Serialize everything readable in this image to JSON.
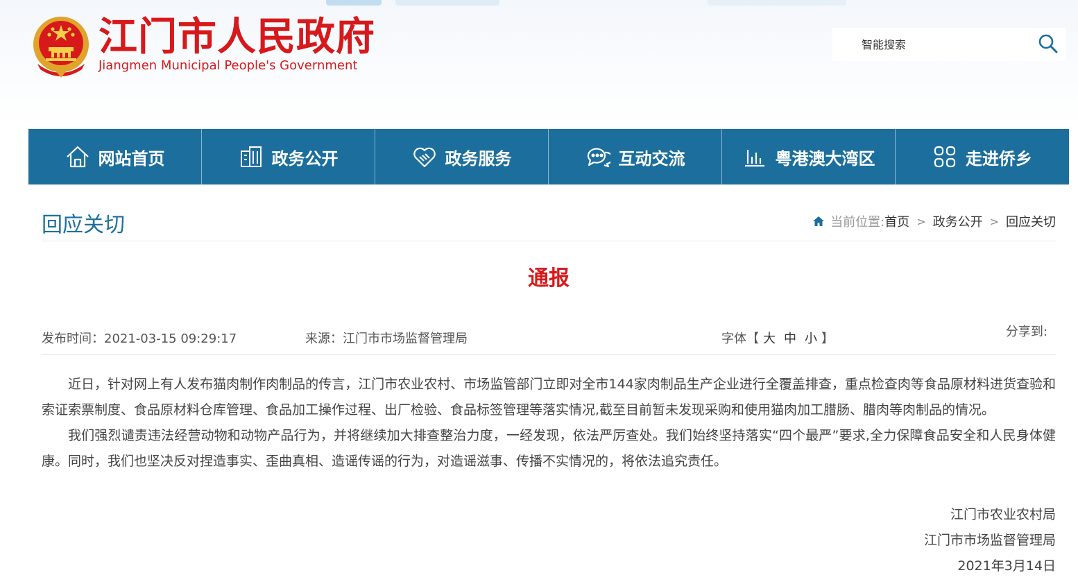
{
  "header": {
    "logo_cn": "江门市人民政府",
    "logo_en": "Jiangmen Municipal People's Government",
    "search_placeholder": "智能搜索",
    "search_icon": "search-icon"
  },
  "nav": {
    "items": [
      {
        "label": "网站首页",
        "icon": "home-icon"
      },
      {
        "label": "政务公开",
        "icon": "building-icon"
      },
      {
        "label": "政务服务",
        "icon": "handshake-heart-icon"
      },
      {
        "label": "互动交流",
        "icon": "chat-icon"
      },
      {
        "label": "粤港澳大湾区",
        "icon": "bar-chart-icon"
      },
      {
        "label": "走进侨乡",
        "icon": "grid-icon"
      }
    ],
    "color": "#1c6e9d"
  },
  "section": {
    "title": "回应关切",
    "breadcrumb": {
      "label": "当前位置:",
      "items": [
        "首页",
        "政务公开",
        "回应关切"
      ],
      "separator": ">"
    }
  },
  "article": {
    "title": "通报",
    "publish_time": "发布时间：2021-03-15 09:29:17",
    "source": "来源：江门市市场监督管理局",
    "font_label": "字体",
    "font_open": "【",
    "font_large": "大",
    "font_medium": "中",
    "font_small": "小",
    "font_close": "】",
    "share_label": "分享到:",
    "paragraphs": [
      "近日，针对网上有人发布猫肉制作肉制品的传言，江门市农业农村、市场监管部门立即对全市144家肉制品生产企业进行全覆盖排查，重点检查肉等食品原材料进货查验和索证索票制度、食品原材料仓库管理、食品加工操作过程、出厂检验、食品标签管理等落实情况,截至目前暂未发现采购和使用猫肉加工腊肠、腊肉等肉制品的情况。",
      "我们强烈谴责违法经营动物和动物产品行为，并将继续加大排查整治力度，一经发现，依法严厉查处。我们始终坚持落实“四个最严”要求,全力保障食品安全和人民身体健康。同时，我们也坚决反对捏造事实、歪曲真相、造谣传谣的行为，对造谣滋事、传播不实情况的，将依法追究责任。"
    ],
    "signatures": [
      "江门市农业农村局",
      "江门市市场监督管理局",
      "2021年3月14日"
    ]
  },
  "colors": {
    "accent_red": "#d7191b",
    "nav_blue": "#1c6e9d"
  }
}
